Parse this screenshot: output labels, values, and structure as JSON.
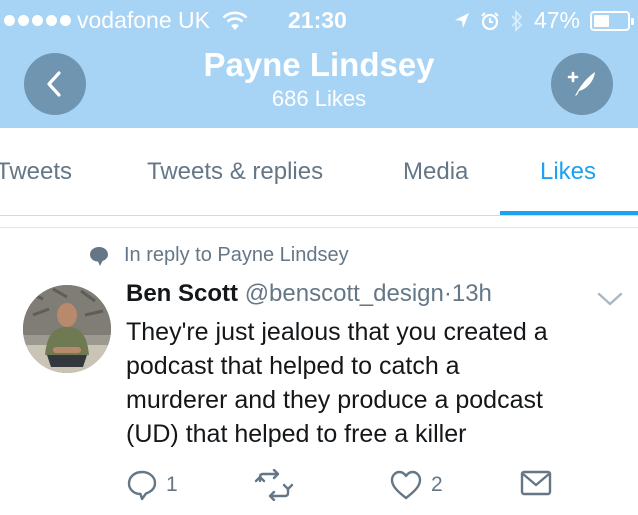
{
  "status_bar": {
    "carrier": "vodafone UK",
    "time": "21:30",
    "battery": "47%",
    "battery_level": 0.47
  },
  "header": {
    "title": "Payne Lindsey",
    "subtitle": "686 Likes"
  },
  "tabs": [
    {
      "label": "Tweets",
      "active": false
    },
    {
      "label": "Tweets & replies",
      "active": false
    },
    {
      "label": "Media",
      "active": false
    },
    {
      "label": "Likes",
      "active": true
    }
  ],
  "tweet": {
    "reply_context": "In reply to Payne Lindsey",
    "author_name": "Ben Scott",
    "author_handle": "@benscott_design",
    "separator": "·",
    "time": "13h",
    "text_lines": [
      "They're just jealous that you created a",
      "podcast that helped to catch a",
      "murderer and they produce a podcast",
      "(UD) that helped to free a killer"
    ],
    "reply_count": "1",
    "like_count": "2"
  },
  "icons": {
    "back": "back-arrow-icon",
    "compose": "compose-tweet-icon",
    "reply": "reply-icon",
    "retweet": "retweet-icon",
    "like": "heart-icon",
    "dm": "mail-icon"
  },
  "colors": {
    "header_bg": "#a7d3f5",
    "button_bg": "#6f95b1",
    "accent": "#1da1f2",
    "muted": "#657786"
  }
}
